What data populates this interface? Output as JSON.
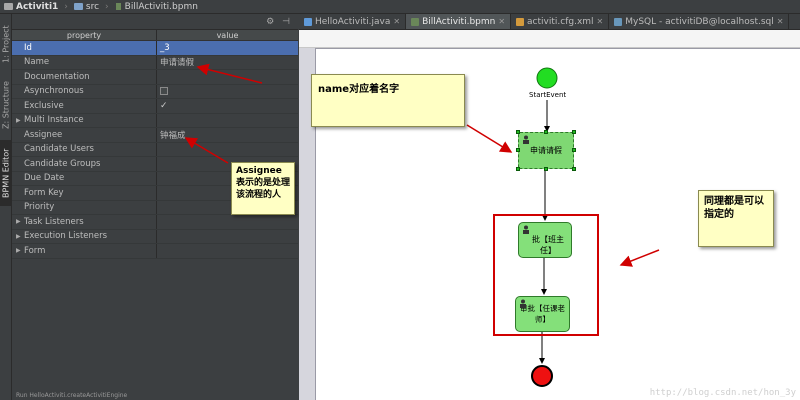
{
  "breadcrumb": {
    "project": "Activiti1",
    "folder": "src",
    "file": "BillActiviti.bpmn"
  },
  "side_tabs": {
    "project": "1: Project",
    "structure": "Z: Structure",
    "bpmn_editor": "BPMN Editor"
  },
  "properties": {
    "col_property": "property",
    "col_value": "value",
    "rows": [
      {
        "name": "Id",
        "value": "_3"
      },
      {
        "name": "Name",
        "value": "申请请假"
      },
      {
        "name": "Documentation",
        "value": ""
      },
      {
        "name": "Asynchronous",
        "value": ""
      },
      {
        "name": "Exclusive",
        "value": "✓"
      },
      {
        "name": "Multi Instance",
        "value": ""
      },
      {
        "name": "Assignee",
        "value": "钟福成"
      },
      {
        "name": "Candidate Users",
        "value": ""
      },
      {
        "name": "Candidate Groups",
        "value": ""
      },
      {
        "name": "Due Date",
        "value": ""
      },
      {
        "name": "Form Key",
        "value": ""
      },
      {
        "name": "Priority",
        "value": ""
      },
      {
        "name": "Task Listeners",
        "value": ""
      },
      {
        "name": "Execution Listeners",
        "value": ""
      },
      {
        "name": "Form",
        "value": ""
      }
    ]
  },
  "tabs": [
    {
      "label": "HelloActiviti.java",
      "color": "#5f9ad9"
    },
    {
      "label": "BillActiviti.bpmn",
      "color": "#6a8759"
    },
    {
      "label": "activiti.cfg.xml",
      "color": "#d49a3c"
    },
    {
      "label": "MySQL - activitiDB@localhost.sql",
      "color": "#6897bb"
    }
  ],
  "diagram": {
    "start_label": "StartEvent",
    "task1": "申请请假",
    "task2": "批【班主任】",
    "task3": "审批【任课老师】"
  },
  "notes": {
    "name_note": "name对应着名字",
    "assignee_note": "Assignee 表示的是处理该流程的人",
    "same_note": "同理都是可以指定的"
  },
  "status": {
    "text": "Run  HelloActiviti.createActivitiEngine"
  },
  "watermark": "http://blog.csdn.net/hon_3y"
}
